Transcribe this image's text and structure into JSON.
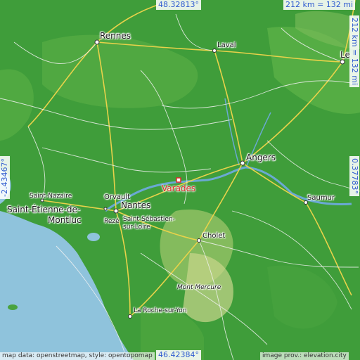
{
  "map": {
    "target": "Varades",
    "coords": {
      "top": "48.32813°",
      "bottom": "46.42384°",
      "left": "-2.43467°",
      "right": "0.37783°"
    },
    "scale": {
      "horizontal": "212 km = 132 mi",
      "vertical": "212 km = 132 mi"
    },
    "credits": {
      "left": "map data: openstreetmap, style: opentopomap",
      "right": "image prov.: elevation.city"
    },
    "places": {
      "rennes": "Rennes",
      "laval": "Laval",
      "le": "Le",
      "angers": "Angers",
      "saumur": "Saumur",
      "cholet": "Cholet",
      "nantes": "Nantes",
      "orvault": "Orvault",
      "reze": "Rezé",
      "saint_nazaire": "Saint-Nazaire",
      "saint_etienne_1": "Saint-Étienne-de-",
      "saint_etienne_2": "Montluc",
      "saint_sebastien_1": "Saint-Sébastien-",
      "saint_sebastien_2": "sur-Loire",
      "mont_mercure": "Mont Mercure",
      "la_roche": "La Roche-sur-Yon"
    },
    "colors": {
      "sea": "#8fc3dc",
      "land": "#3d9c3a",
      "marker": "#e0282b",
      "coord_text": "#2f5bd0"
    }
  }
}
